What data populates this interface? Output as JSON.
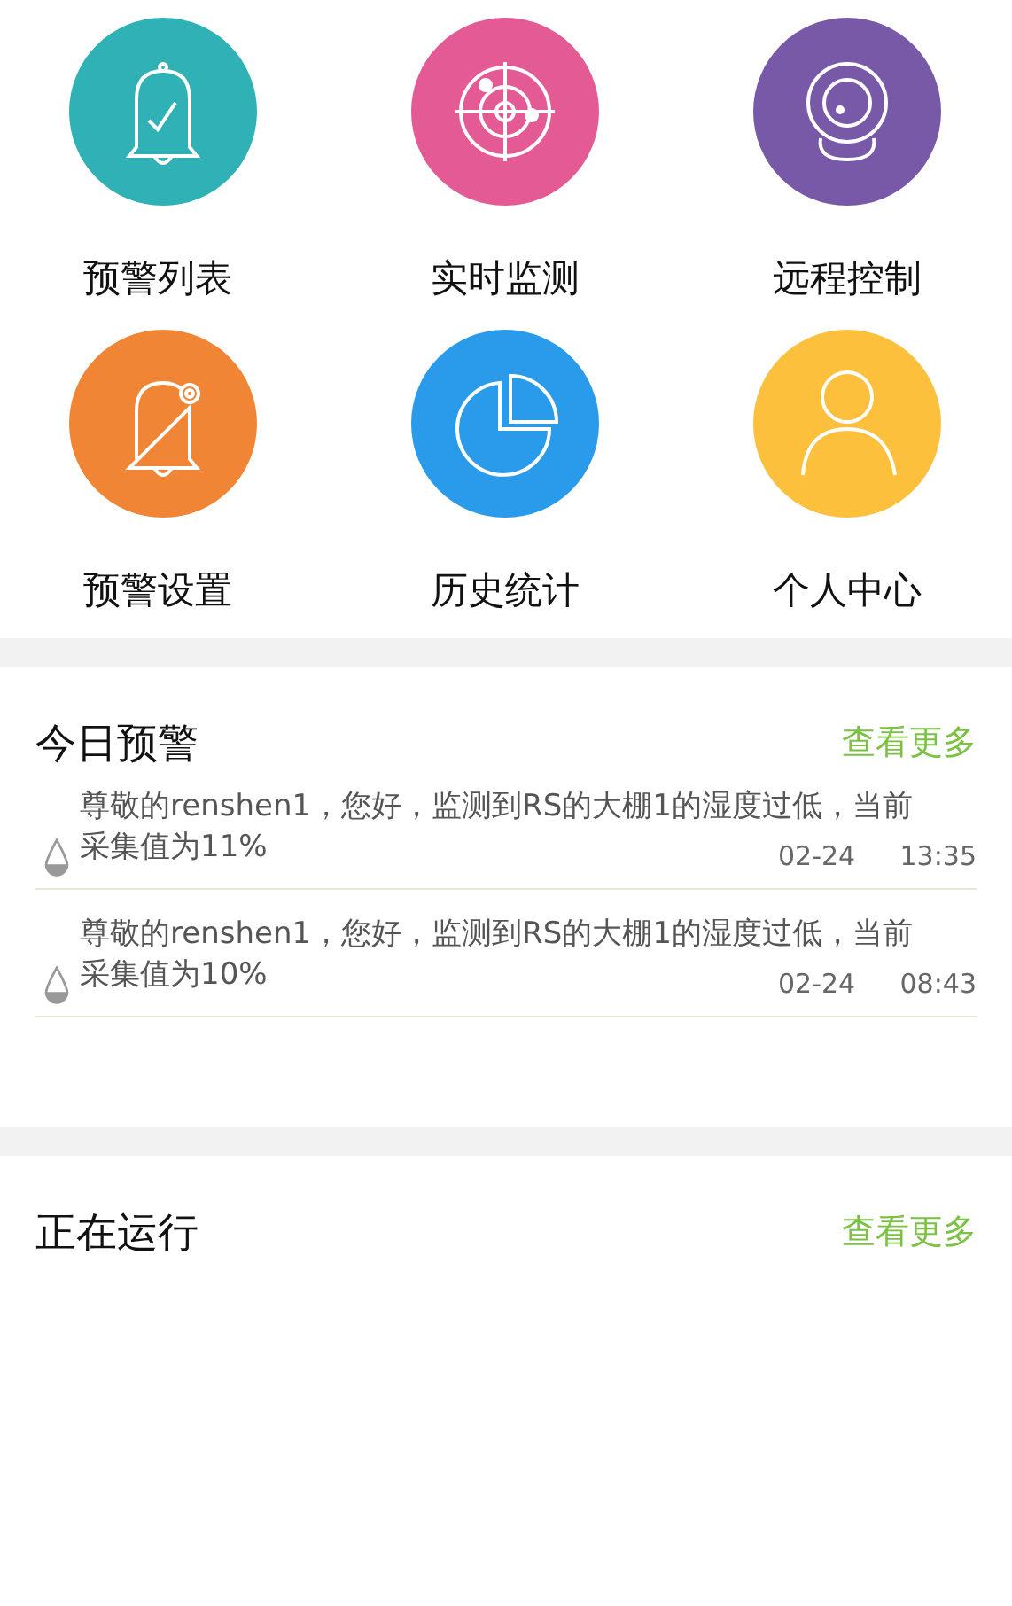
{
  "menu": [
    {
      "label": "预警列表",
      "kind": "bellcheck",
      "color": "#2fb1b5"
    },
    {
      "label": "实时监测",
      "kind": "radar",
      "color": "#e35a95"
    },
    {
      "label": "远程控制",
      "kind": "camera",
      "color": "#7759a8"
    },
    {
      "label": "预警设置",
      "kind": "bellgear",
      "color": "#ef8535"
    },
    {
      "label": "历史统计",
      "kind": "pie",
      "color": "#2a9bea"
    },
    {
      "label": "个人中心",
      "kind": "person",
      "color": "#fcc03c"
    }
  ],
  "today_alerts": {
    "title": "今日预警",
    "more": "查看更多",
    "items": [
      {
        "lines": [
          "尊敬的renshen1，您好，监测到RS的大棚1的湿度过低，当前",
          "采集值为11%"
        ],
        "date": "02-24",
        "time": "13:35"
      },
      {
        "lines": [
          "尊敬的renshen1，您好，监测到RS的大棚1的湿度过低，当前",
          "采集值为10%"
        ],
        "date": "02-24",
        "time": "08:43"
      }
    ]
  },
  "running": {
    "title": "正在运行",
    "more": "查看更多"
  }
}
